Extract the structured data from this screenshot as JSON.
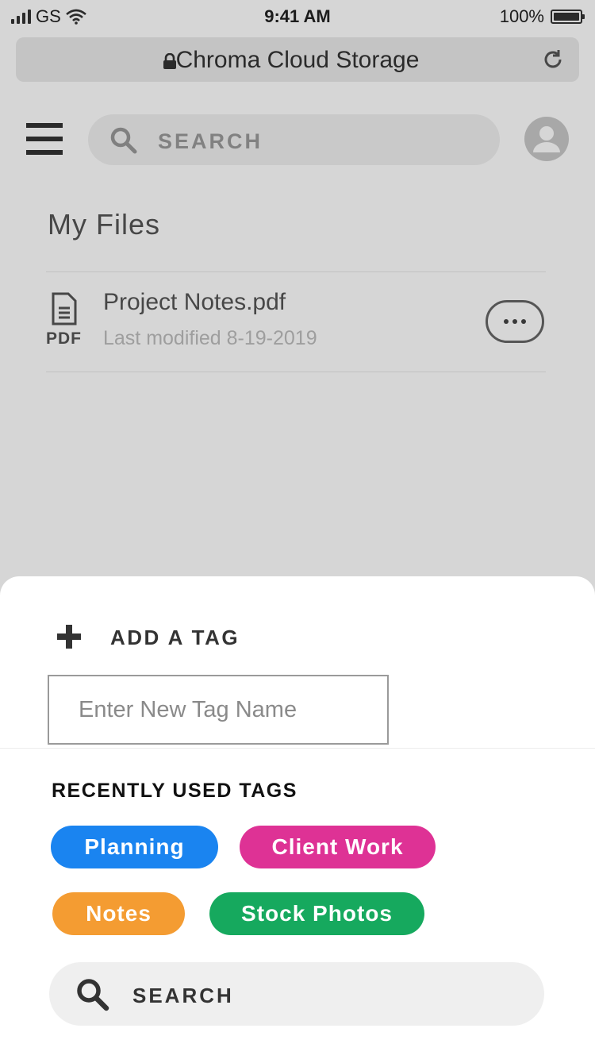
{
  "status_bar": {
    "carrier": "GS",
    "time": "9:41 AM",
    "battery": "100%"
  },
  "browser": {
    "url_title": "Chroma Cloud Storage"
  },
  "header": {
    "search_placeholder": "SEARCH"
  },
  "main": {
    "title": "My Files",
    "files": [
      {
        "name": "Project Notes.pdf",
        "type": "PDF",
        "modified": "Last modified 8-19-2019"
      }
    ]
  },
  "sheet": {
    "add_tag_label": "ADD A TAG",
    "tag_input_placeholder": "Enter New Tag Name",
    "recent_label": "RECENTLY USED TAGS",
    "tags": [
      {
        "label": "Planning",
        "color": "#1a84f0"
      },
      {
        "label": "Client Work",
        "color": "#de3295"
      },
      {
        "label": "Notes",
        "color": "#f49c32"
      },
      {
        "label": "Stock Photos",
        "color": "#16a95e"
      }
    ],
    "search_label": "SEARCH"
  }
}
